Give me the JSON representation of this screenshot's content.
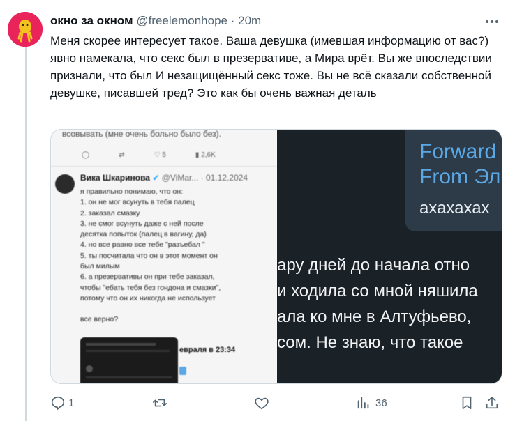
{
  "author": {
    "display_name": "окно за окном",
    "handle": "@freelemonhope",
    "separator": "·",
    "time": "20m"
  },
  "tweet": {
    "text": "Меня скорее интересует такое. Ваша девушка (имевшая информацию от вас?) явно намекала, что секс был в презервативе, а Мира врёт. Вы же впоследствии признали, что был И незащищённый секс тоже. Вы не всё сказали собственной девушке, писавшей тред? Это как бы очень важная деталь"
  },
  "media_left": {
    "top_text": "всовывать (мне очень больно было без).",
    "stats": {
      "views": "2,6K",
      "likes": "5"
    },
    "quoted_name": "Вика Шкаринова",
    "quoted_meta": "@ViMar... · 01.12.2024",
    "lines": [
      "я правильно понимаю, что он:",
      "1. он не мог всунуть в тебя палец",
      "2. заказал смазку",
      "3. не смог всунуть даже с ней после",
      "десятка попыток (палец в вагину, да)",
      "4. но все равно все тебе \"разъебал \"",
      "5. ты посчитала что он в этот момент он",
      "был милым",
      "6. а презервативы он при тебе заказал,",
      "чтобы \"ебать тебя  без гондона и смазки\",",
      "потому что он их никогда не использует",
      "",
      "все верно?"
    ],
    "bottom_caption": "евраля в 23:34"
  },
  "media_right": {
    "forward_line1": "Forward",
    "forward_line2": "From Эл",
    "laugh": "ахахахах",
    "lines": [
      "ару дней до начала отно",
      "и ходила со мной няшила",
      "ала ко мне в Алтуфьево,",
      "сом. Не знаю, что такое"
    ]
  },
  "actions": {
    "replies": "1",
    "views": "36"
  }
}
